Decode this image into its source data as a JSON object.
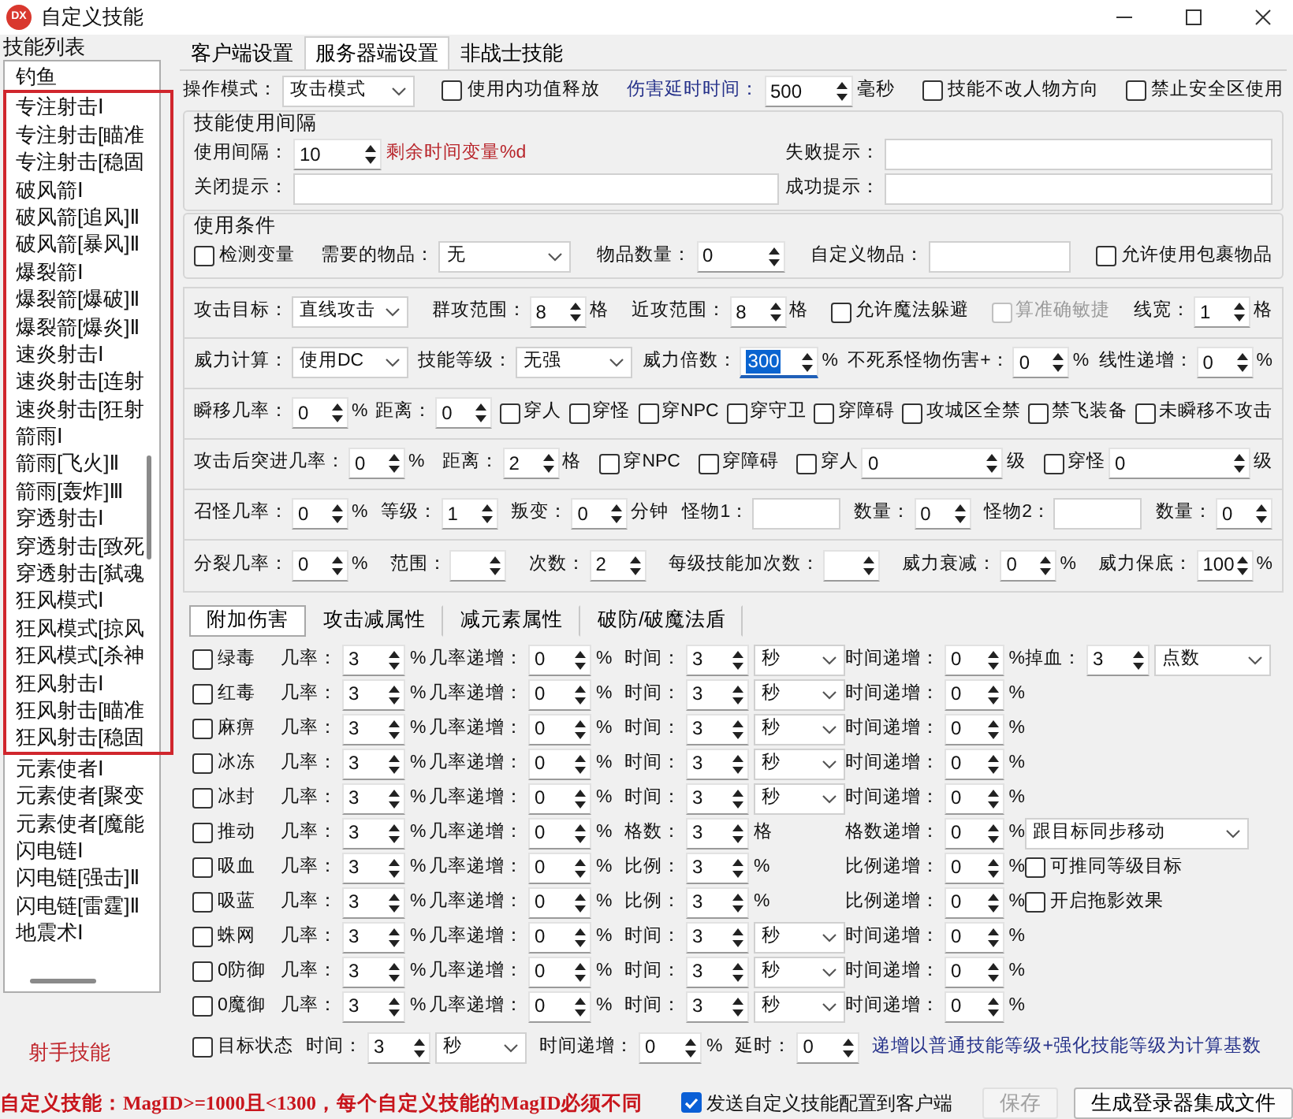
{
  "window": {
    "icon_text": "DX",
    "title": "自定义技能"
  },
  "skill_list": {
    "title": "技能列表",
    "footer": "射手技能",
    "items": [
      {
        "text": "钓鱼",
        "highlighted": false
      },
      {
        "text": "专注射击Ⅰ",
        "highlighted": true
      },
      {
        "text": "专注射击[瞄准",
        "highlighted": true
      },
      {
        "text": "专注射击[稳固",
        "highlighted": true
      },
      {
        "text": "破风箭Ⅰ",
        "highlighted": true
      },
      {
        "text": "破风箭[追风]Ⅱ",
        "highlighted": true
      },
      {
        "text": "破风箭[暴风]Ⅱ",
        "highlighted": true
      },
      {
        "text": "爆裂箭Ⅰ",
        "highlighted": true
      },
      {
        "text": "爆裂箭[爆破]Ⅱ",
        "highlighted": true
      },
      {
        "text": "爆裂箭[爆炎]Ⅱ",
        "highlighted": true
      },
      {
        "text": "速炎射击Ⅰ",
        "highlighted": true
      },
      {
        "text": "速炎射击[连射",
        "highlighted": true
      },
      {
        "text": "速炎射击[狂射",
        "highlighted": true
      },
      {
        "text": "箭雨Ⅰ",
        "highlighted": true
      },
      {
        "text": "箭雨[飞火]Ⅱ",
        "highlighted": true
      },
      {
        "text": "箭雨[轰炸]Ⅲ",
        "highlighted": true
      },
      {
        "text": "穿透射击Ⅰ",
        "highlighted": true
      },
      {
        "text": "穿透射击[致死",
        "highlighted": true
      },
      {
        "text": "穿透射击[弑魂",
        "highlighted": true
      },
      {
        "text": "狂风模式Ⅰ",
        "highlighted": true
      },
      {
        "text": "狂风模式[掠风",
        "highlighted": true
      },
      {
        "text": "狂风模式[杀神",
        "highlighted": true
      },
      {
        "text": "狂风射击Ⅰ",
        "highlighted": true
      },
      {
        "text": "狂风射击[瞄准",
        "highlighted": true
      },
      {
        "text": "狂风射击[稳固",
        "highlighted": true
      },
      {
        "text": "元素使者Ⅰ",
        "highlighted": false
      },
      {
        "text": "元素使者[聚变",
        "highlighted": false
      },
      {
        "text": "元素使者[魔能",
        "highlighted": false
      },
      {
        "text": "闪电链Ⅰ",
        "highlighted": false
      },
      {
        "text": "闪电链[强击]Ⅱ",
        "highlighted": false
      },
      {
        "text": "闪电链[雷霆]Ⅱ",
        "highlighted": false
      },
      {
        "text": "地震术Ⅰ",
        "highlighted": false
      }
    ]
  },
  "tabs": [
    {
      "label": "客户端设置",
      "selected": false
    },
    {
      "label": "服务器端设置",
      "selected": true
    },
    {
      "label": "非战士技能",
      "selected": false
    }
  ],
  "top_row": {
    "cells": [
      {
        "items": [
          {
            "kind": "label",
            "text": "操作模式："
          },
          {
            "kind": "select",
            "value": "攻击模式"
          }
        ]
      },
      {
        "items": [
          {
            "kind": "check",
            "label": "使用内功值释放",
            "checked": false
          }
        ]
      },
      {
        "items": [
          {
            "kind": "label",
            "text": "伤害延时时间：",
            "color": "#26328a"
          },
          {
            "kind": "spin",
            "value": "500"
          },
          {
            "kind": "unit",
            "text": "毫秒"
          }
        ]
      },
      {
        "items": [
          {
            "kind": "check",
            "label": "技能不改人物方向",
            "checked": false
          }
        ]
      },
      {
        "items": [
          {
            "kind": "check",
            "label": "禁止安全区使用",
            "checked": false
          }
        ]
      }
    ]
  },
  "interval_group": {
    "title": "技能使用间隔",
    "rows": [
      {
        "cells": [
          {
            "items": [
              {
                "kind": "label",
                "text": "使用间隔："
              },
              {
                "kind": "spin",
                "value": "10"
              },
              {
                "kind": "note",
                "text": "剩余时间变量%d",
                "color": "#b8252b"
              }
            ]
          },
          {
            "items": [
              {
                "kind": "label",
                "text": "失败提示："
              },
              {
                "kind": "input"
              }
            ]
          }
        ]
      },
      {
        "cells": [
          {
            "items": [
              {
                "kind": "label",
                "text": "关闭提示："
              },
              {
                "kind": "input"
              }
            ]
          },
          {
            "items": [
              {
                "kind": "label",
                "text": "成功提示："
              },
              {
                "kind": "input"
              }
            ]
          }
        ]
      }
    ]
  },
  "condition_group": {
    "title": "使用条件",
    "rows": [
      {
        "cells": [
          {
            "items": [
              {
                "kind": "check",
                "label": "检测变量",
                "checked": false
              }
            ]
          },
          {
            "items": [
              {
                "kind": "label",
                "text": "需要的物品："
              },
              {
                "kind": "select",
                "value": "无"
              }
            ]
          },
          {
            "items": [
              {
                "kind": "label",
                "text": "物品数量："
              },
              {
                "kind": "spin",
                "value": "0"
              }
            ]
          },
          {
            "items": [
              {
                "kind": "label",
                "text": "自定义物品："
              },
              {
                "kind": "input"
              }
            ]
          },
          {
            "items": [
              {
                "kind": "check",
                "label": "允许使用包裹物品",
                "checked": false
              }
            ]
          }
        ]
      }
    ]
  },
  "attack_rows": [
    {
      "cells": [
        {
          "items": [
            {
              "kind": "label",
              "text": "攻击目标："
            },
            {
              "kind": "select",
              "value": "直线攻击"
            }
          ]
        },
        {
          "items": [
            {
              "kind": "label",
              "text": "群攻范围："
            },
            {
              "kind": "spin",
              "value": "8"
            },
            {
              "kind": "unit",
              "text": "格"
            }
          ]
        },
        {
          "items": [
            {
              "kind": "label",
              "text": "近攻范围："
            },
            {
              "kind": "spin",
              "value": "8"
            },
            {
              "kind": "unit",
              "text": "格"
            }
          ]
        },
        {
          "items": [
            {
              "kind": "check",
              "label": "允许魔法躲避",
              "checked": false
            }
          ]
        },
        {
          "items": [
            {
              "kind": "check",
              "label": "算准确敏捷",
              "checked": false,
              "disabled": true
            }
          ]
        },
        {
          "items": [
            {
              "kind": "label",
              "text": "线宽："
            },
            {
              "kind": "spin",
              "value": "1"
            },
            {
              "kind": "unit",
              "text": "格"
            }
          ]
        }
      ]
    },
    {
      "cells": [
        {
          "items": [
            {
              "kind": "label",
              "text": "威力计算："
            },
            {
              "kind": "select",
              "value": "使用DC"
            }
          ]
        },
        {
          "items": [
            {
              "kind": "label",
              "text": "技能等级："
            },
            {
              "kind": "select",
              "value": "无强"
            }
          ]
        },
        {
          "items": [
            {
              "kind": "label",
              "text": "威力倍数："
            },
            {
              "kind": "spin",
              "value": "300",
              "selected": true
            },
            {
              "kind": "unit",
              "text": "%"
            }
          ]
        },
        {
          "items": [
            {
              "kind": "label",
              "text": "不死系怪物伤害+："
            },
            {
              "kind": "spin",
              "value": "0"
            },
            {
              "kind": "unit",
              "text": "%"
            }
          ]
        },
        {
          "items": [
            {
              "kind": "label",
              "text": "线性递增："
            },
            {
              "kind": "spin",
              "value": "0"
            },
            {
              "kind": "unit",
              "text": "%"
            }
          ]
        }
      ]
    },
    {
      "cells": [
        {
          "items": [
            {
              "kind": "label",
              "text": "瞬移几率："
            },
            {
              "kind": "spin",
              "value": "0"
            },
            {
              "kind": "unit",
              "text": "%"
            }
          ]
        },
        {
          "items": [
            {
              "kind": "label",
              "text": "距离："
            },
            {
              "kind": "spin",
              "value": "0"
            }
          ]
        },
        {
          "items": [
            {
              "kind": "check",
              "label": "穿人",
              "checked": false
            }
          ]
        },
        {
          "items": [
            {
              "kind": "check",
              "label": "穿怪",
              "checked": false
            }
          ]
        },
        {
          "items": [
            {
              "kind": "check",
              "label": "穿NPC",
              "checked": false
            }
          ]
        },
        {
          "items": [
            {
              "kind": "check",
              "label": "穿守卫",
              "checked": false
            }
          ]
        },
        {
          "items": [
            {
              "kind": "check",
              "label": "穿障碍",
              "checked": false
            }
          ]
        },
        {
          "items": [
            {
              "kind": "check",
              "label": "攻城区全禁",
              "checked": false
            }
          ]
        },
        {
          "items": [
            {
              "kind": "check",
              "label": "禁飞装备",
              "checked": false
            }
          ]
        },
        {
          "items": [
            {
              "kind": "check",
              "label": "未瞬移不攻击",
              "checked": false
            }
          ]
        }
      ]
    },
    {
      "cells": [
        {
          "items": [
            {
              "kind": "label",
              "text": "攻击后突进几率："
            },
            {
              "kind": "spin",
              "value": "0"
            },
            {
              "kind": "unit",
              "text": "%"
            }
          ]
        },
        {
          "items": [
            {
              "kind": "label",
              "text": "距离："
            },
            {
              "kind": "spin",
              "value": "2"
            },
            {
              "kind": "unit",
              "text": "格"
            }
          ]
        },
        {
          "items": [
            {
              "kind": "check",
              "label": "穿NPC",
              "checked": false
            }
          ]
        },
        {
          "items": [
            {
              "kind": "check",
              "label": "穿障碍",
              "checked": false
            }
          ]
        },
        {
          "items": [
            {
              "kind": "check",
              "label": "穿人",
              "checked": false
            },
            {
              "kind": "spin",
              "value": "0"
            },
            {
              "kind": "unit",
              "text": "级"
            }
          ]
        },
        {
          "items": [
            {
              "kind": "check",
              "label": "穿怪",
              "checked": false
            },
            {
              "kind": "spin",
              "value": "0"
            },
            {
              "kind": "unit",
              "text": "级"
            }
          ]
        }
      ]
    },
    {
      "cells": [
        {
          "items": [
            {
              "kind": "label",
              "text": "召怪几率："
            },
            {
              "kind": "spin",
              "value": "0"
            },
            {
              "kind": "unit",
              "text": "%"
            }
          ]
        },
        {
          "items": [
            {
              "kind": "label",
              "text": "等级："
            },
            {
              "kind": "spin",
              "value": "1"
            }
          ]
        },
        {
          "items": [
            {
              "kind": "label",
              "text": "叛变："
            },
            {
              "kind": "spin",
              "value": "0"
            },
            {
              "kind": "unit",
              "text": "分钟"
            }
          ]
        },
        {
          "items": [
            {
              "kind": "label",
              "text": "怪物1："
            },
            {
              "kind": "input"
            }
          ]
        },
        {
          "items": [
            {
              "kind": "label",
              "text": "数量："
            },
            {
              "kind": "spin",
              "value": "0"
            }
          ]
        },
        {
          "items": [
            {
              "kind": "label",
              "text": "怪物2："
            },
            {
              "kind": "input"
            }
          ]
        },
        {
          "items": [
            {
              "kind": "label",
              "text": "数量："
            },
            {
              "kind": "spin",
              "value": "0"
            }
          ]
        }
      ]
    },
    {
      "cells": [
        {
          "items": [
            {
              "kind": "label",
              "text": "分裂几率："
            },
            {
              "kind": "spin",
              "value": "0"
            },
            {
              "kind": "unit",
              "text": "%"
            }
          ]
        },
        {
          "items": [
            {
              "kind": "label",
              "text": "范围："
            },
            {
              "kind": "spin"
            }
          ]
        },
        {
          "items": [
            {
              "kind": "label",
              "text": "次数："
            },
            {
              "kind": "spin",
              "value": "2"
            }
          ]
        },
        {
          "items": [
            {
              "kind": "label",
              "text": "每级技能加次数："
            },
            {
              "kind": "spin"
            }
          ]
        },
        {
          "items": [
            {
              "kind": "label",
              "text": "威力衰减："
            },
            {
              "kind": "spin",
              "value": "0"
            },
            {
              "kind": "unit",
              "text": "%"
            }
          ]
        },
        {
          "items": [
            {
              "kind": "label",
              "text": "威力保底："
            },
            {
              "kind": "spin",
              "value": "100"
            },
            {
              "kind": "unit",
              "text": "%"
            }
          ]
        }
      ]
    }
  ],
  "sub_tabs": [
    {
      "label": "附加伤害",
      "selected": true
    },
    {
      "label": "攻击减属性",
      "selected": false
    },
    {
      "label": "减元素属性",
      "selected": false
    },
    {
      "label": "破防/破魔法盾",
      "selected": false
    }
  ],
  "effect_rows": [
    {
      "cells": [
        {
          "items": [
            {
              "kind": "check",
              "label": "绿毒",
              "checked": false
            }
          ]
        },
        {
          "items": [
            {
              "kind": "label",
              "text": "几率："
            },
            {
              "kind": "spin",
              "value": "3"
            },
            {
              "kind": "unit",
              "text": "%"
            }
          ]
        },
        {
          "items": [
            {
              "kind": "label",
              "text": "几率递增："
            },
            {
              "kind": "spin",
              "value": "0"
            },
            {
              "kind": "unit",
              "text": "%"
            }
          ]
        },
        {
          "items": [
            {
              "kind": "label",
              "text": "时间："
            },
            {
              "kind": "spin",
              "value": "3"
            },
            {
              "kind": "select",
              "value": "秒"
            }
          ]
        },
        {
          "items": [
            {
              "kind": "label",
              "text": "时间递增："
            },
            {
              "kind": "spin",
              "value": "0"
            },
            {
              "kind": "unit",
              "text": "%"
            }
          ]
        },
        {
          "items": [
            {
              "kind": "label",
              "text": "掉血："
            },
            {
              "kind": "spin",
              "value": "3"
            },
            {
              "kind": "select",
              "value": "点数"
            }
          ]
        }
      ]
    },
    {
      "cells": [
        {
          "items": [
            {
              "kind": "check",
              "label": "红毒",
              "checked": false
            }
          ]
        },
        {
          "items": [
            {
              "kind": "label",
              "text": "几率："
            },
            {
              "kind": "spin",
              "value": "3"
            },
            {
              "kind": "unit",
              "text": "%"
            }
          ]
        },
        {
          "items": [
            {
              "kind": "label",
              "text": "几率递增："
            },
            {
              "kind": "spin",
              "value": "0"
            },
            {
              "kind": "unit",
              "text": "%"
            }
          ]
        },
        {
          "items": [
            {
              "kind": "label",
              "text": "时间："
            },
            {
              "kind": "spin",
              "value": "3"
            },
            {
              "kind": "select",
              "value": "秒"
            }
          ]
        },
        {
          "items": [
            {
              "kind": "label",
              "text": "时间递增："
            },
            {
              "kind": "spin",
              "value": "0"
            },
            {
              "kind": "unit",
              "text": "%"
            }
          ]
        }
      ]
    },
    {
      "cells": [
        {
          "items": [
            {
              "kind": "check",
              "label": "麻痹",
              "checked": false
            }
          ]
        },
        {
          "items": [
            {
              "kind": "label",
              "text": "几率："
            },
            {
              "kind": "spin",
              "value": "3"
            },
            {
              "kind": "unit",
              "text": "%"
            }
          ]
        },
        {
          "items": [
            {
              "kind": "label",
              "text": "几率递增："
            },
            {
              "kind": "spin",
              "value": "0"
            },
            {
              "kind": "unit",
              "text": "%"
            }
          ]
        },
        {
          "items": [
            {
              "kind": "label",
              "text": "时间："
            },
            {
              "kind": "spin",
              "value": "3"
            },
            {
              "kind": "select",
              "value": "秒"
            }
          ]
        },
        {
          "items": [
            {
              "kind": "label",
              "text": "时间递增："
            },
            {
              "kind": "spin",
              "value": "0"
            },
            {
              "kind": "unit",
              "text": "%"
            }
          ]
        }
      ]
    },
    {
      "cells": [
        {
          "items": [
            {
              "kind": "check",
              "label": "冰冻",
              "checked": false
            }
          ]
        },
        {
          "items": [
            {
              "kind": "label",
              "text": "几率："
            },
            {
              "kind": "spin",
              "value": "3"
            },
            {
              "kind": "unit",
              "text": "%"
            }
          ]
        },
        {
          "items": [
            {
              "kind": "label",
              "text": "几率递增："
            },
            {
              "kind": "spin",
              "value": "0"
            },
            {
              "kind": "unit",
              "text": "%"
            }
          ]
        },
        {
          "items": [
            {
              "kind": "label",
              "text": "时间："
            },
            {
              "kind": "spin",
              "value": "3"
            },
            {
              "kind": "select",
              "value": "秒"
            }
          ]
        },
        {
          "items": [
            {
              "kind": "label",
              "text": "时间递增："
            },
            {
              "kind": "spin",
              "value": "0"
            },
            {
              "kind": "unit",
              "text": "%"
            }
          ]
        }
      ]
    },
    {
      "cells": [
        {
          "items": [
            {
              "kind": "check",
              "label": "冰封",
              "checked": false
            }
          ]
        },
        {
          "items": [
            {
              "kind": "label",
              "text": "几率："
            },
            {
              "kind": "spin",
              "value": "3"
            },
            {
              "kind": "unit",
              "text": "%"
            }
          ]
        },
        {
          "items": [
            {
              "kind": "label",
              "text": "几率递增："
            },
            {
              "kind": "spin",
              "value": "0"
            },
            {
              "kind": "unit",
              "text": "%"
            }
          ]
        },
        {
          "items": [
            {
              "kind": "label",
              "text": "时间："
            },
            {
              "kind": "spin",
              "value": "3"
            },
            {
              "kind": "select",
              "value": "秒"
            }
          ]
        },
        {
          "items": [
            {
              "kind": "label",
              "text": "时间递增："
            },
            {
              "kind": "spin",
              "value": "0"
            },
            {
              "kind": "unit",
              "text": "%"
            }
          ]
        }
      ]
    },
    {
      "cells": [
        {
          "items": [
            {
              "kind": "check",
              "label": "推动",
              "checked": false
            }
          ]
        },
        {
          "items": [
            {
              "kind": "label",
              "text": "几率："
            },
            {
              "kind": "spin",
              "value": "3"
            },
            {
              "kind": "unit",
              "text": "%"
            }
          ]
        },
        {
          "items": [
            {
              "kind": "label",
              "text": "几率递增："
            },
            {
              "kind": "spin",
              "value": "0"
            },
            {
              "kind": "unit",
              "text": "%"
            }
          ]
        },
        {
          "items": [
            {
              "kind": "label",
              "text": "格数："
            },
            {
              "kind": "spin",
              "value": "3"
            },
            {
              "kind": "unit",
              "text": "格"
            }
          ]
        },
        {
          "items": [
            {
              "kind": "label",
              "text": "格数递增："
            },
            {
              "kind": "spin",
              "value": "0"
            },
            {
              "kind": "unit",
              "text": "%"
            }
          ]
        },
        {
          "items": [
            {
              "kind": "select",
              "value": "跟目标同步移动"
            }
          ]
        }
      ]
    },
    {
      "cells": [
        {
          "items": [
            {
              "kind": "check",
              "label": "吸血",
              "checked": false
            }
          ]
        },
        {
          "items": [
            {
              "kind": "label",
              "text": "几率："
            },
            {
              "kind": "spin",
              "value": "3"
            },
            {
              "kind": "unit",
              "text": "%"
            }
          ]
        },
        {
          "items": [
            {
              "kind": "label",
              "text": "几率递增："
            },
            {
              "kind": "spin",
              "value": "0"
            },
            {
              "kind": "unit",
              "text": "%"
            }
          ]
        },
        {
          "items": [
            {
              "kind": "label",
              "text": "比例："
            },
            {
              "kind": "spin",
              "value": "3"
            },
            {
              "kind": "unit",
              "text": "%"
            }
          ]
        },
        {
          "items": [
            {
              "kind": "label",
              "text": "比例递增："
            },
            {
              "kind": "spin",
              "value": "0"
            },
            {
              "kind": "unit",
              "text": "%"
            }
          ]
        },
        {
          "items": [
            {
              "kind": "check",
              "label": "可推同等级目标",
              "checked": false
            }
          ]
        }
      ]
    },
    {
      "cells": [
        {
          "items": [
            {
              "kind": "check",
              "label": "吸蓝",
              "checked": false
            }
          ]
        },
        {
          "items": [
            {
              "kind": "label",
              "text": "几率："
            },
            {
              "kind": "spin",
              "value": "3"
            },
            {
              "kind": "unit",
              "text": "%"
            }
          ]
        },
        {
          "items": [
            {
              "kind": "label",
              "text": "几率递增："
            },
            {
              "kind": "spin",
              "value": "0"
            },
            {
              "kind": "unit",
              "text": "%"
            }
          ]
        },
        {
          "items": [
            {
              "kind": "label",
              "text": "比例："
            },
            {
              "kind": "spin",
              "value": "3"
            },
            {
              "kind": "unit",
              "text": "%"
            }
          ]
        },
        {
          "items": [
            {
              "kind": "label",
              "text": "比例递增："
            },
            {
              "kind": "spin",
              "value": "0"
            },
            {
              "kind": "unit",
              "text": "%"
            }
          ]
        },
        {
          "items": [
            {
              "kind": "check",
              "label": "开启拖影效果",
              "checked": false
            }
          ]
        }
      ]
    },
    {
      "cells": [
        {
          "items": [
            {
              "kind": "check",
              "label": "蛛网",
              "checked": false
            }
          ]
        },
        {
          "items": [
            {
              "kind": "label",
              "text": "几率："
            },
            {
              "kind": "spin",
              "value": "3"
            },
            {
              "kind": "unit",
              "text": "%"
            }
          ]
        },
        {
          "items": [
            {
              "kind": "label",
              "text": "几率递增："
            },
            {
              "kind": "spin",
              "value": "0"
            },
            {
              "kind": "unit",
              "text": "%"
            }
          ]
        },
        {
          "items": [
            {
              "kind": "label",
              "text": "时间："
            },
            {
              "kind": "spin",
              "value": "3"
            },
            {
              "kind": "select",
              "value": "秒"
            }
          ]
        },
        {
          "items": [
            {
              "kind": "label",
              "text": "时间递增："
            },
            {
              "kind": "spin",
              "value": "0"
            },
            {
              "kind": "unit",
              "text": "%"
            }
          ]
        }
      ]
    },
    {
      "cells": [
        {
          "items": [
            {
              "kind": "check",
              "label": "0防御",
              "checked": false
            }
          ]
        },
        {
          "items": [
            {
              "kind": "label",
              "text": "几率："
            },
            {
              "kind": "spin",
              "value": "3"
            },
            {
              "kind": "unit",
              "text": "%"
            }
          ]
        },
        {
          "items": [
            {
              "kind": "label",
              "text": "几率递增："
            },
            {
              "kind": "spin",
              "value": "0"
            },
            {
              "kind": "unit",
              "text": "%"
            }
          ]
        },
        {
          "items": [
            {
              "kind": "label",
              "text": "时间："
            },
            {
              "kind": "spin",
              "value": "3"
            },
            {
              "kind": "select",
              "value": "秒"
            }
          ]
        },
        {
          "items": [
            {
              "kind": "label",
              "text": "时间递增："
            },
            {
              "kind": "spin",
              "value": "0"
            },
            {
              "kind": "unit",
              "text": "%"
            }
          ]
        }
      ]
    },
    {
      "cells": [
        {
          "items": [
            {
              "kind": "check",
              "label": "0魔御",
              "checked": false
            }
          ]
        },
        {
          "items": [
            {
              "kind": "label",
              "text": "几率："
            },
            {
              "kind": "spin",
              "value": "3"
            },
            {
              "kind": "unit",
              "text": "%"
            }
          ]
        },
        {
          "items": [
            {
              "kind": "label",
              "text": "几率递增："
            },
            {
              "kind": "spin",
              "value": "0"
            },
            {
              "kind": "unit",
              "text": "%"
            }
          ]
        },
        {
          "items": [
            {
              "kind": "label",
              "text": "时间："
            },
            {
              "kind": "spin",
              "value": "3"
            },
            {
              "kind": "select",
              "value": "秒"
            }
          ]
        },
        {
          "items": [
            {
              "kind": "label",
              "text": "时间递增："
            },
            {
              "kind": "spin",
              "value": "0"
            },
            {
              "kind": "unit",
              "text": "%"
            }
          ]
        }
      ]
    }
  ],
  "status_row": {
    "cells": [
      {
        "items": [
          {
            "kind": "check",
            "label": "目标状态",
            "checked": false
          }
        ]
      },
      {
        "items": [
          {
            "kind": "label",
            "text": "时间："
          },
          {
            "kind": "spin",
            "value": "3"
          },
          {
            "kind": "select",
            "value": "秒"
          }
        ]
      },
      {
        "items": [
          {
            "kind": "label",
            "text": "时间递增："
          },
          {
            "kind": "spin",
            "value": "0"
          },
          {
            "kind": "unit",
            "text": "%"
          }
        ]
      },
      {
        "items": [
          {
            "kind": "label",
            "text": "延时："
          },
          {
            "kind": "spin",
            "value": "0"
          }
        ]
      },
      {
        "items": [
          {
            "kind": "note",
            "text": "递增以普通技能等级+强化技能等级为计算基数",
            "color": "#26328a"
          }
        ]
      }
    ]
  },
  "footer": {
    "notice": "自定义技能：MagID>=1000且<1300，每个自定义技能的MagID必须不同",
    "send_check": {
      "label": "发送自定义技能配置到客户端",
      "checked": true
    },
    "buttons": [
      {
        "label": "保存",
        "disabled": true
      },
      {
        "label": "生成登录器集成文件",
        "disabled": false
      }
    ]
  }
}
